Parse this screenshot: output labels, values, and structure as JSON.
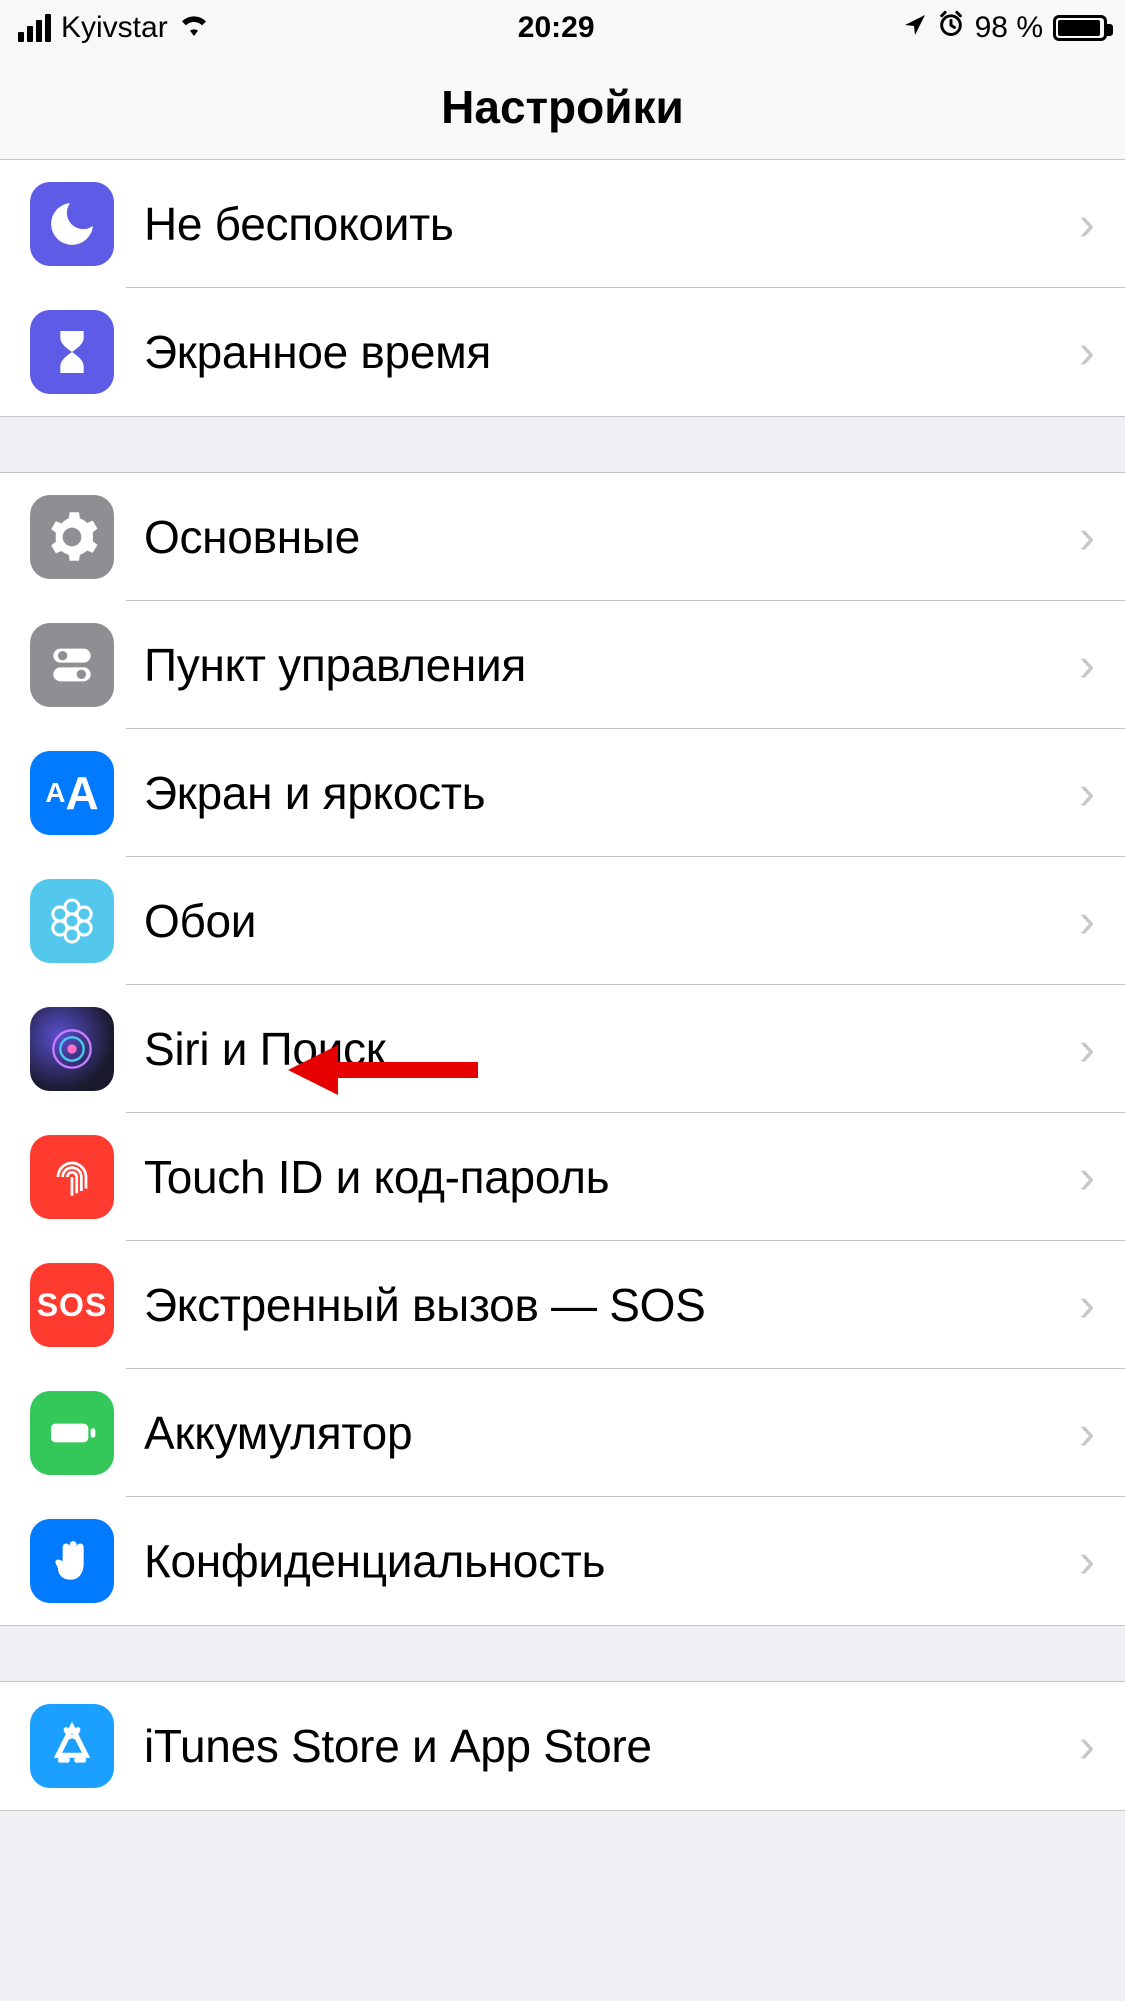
{
  "status_bar": {
    "carrier": "Kyivstar",
    "time": "20:29",
    "battery_pct": "98 %"
  },
  "header": {
    "title": "Настройки"
  },
  "sections": [
    {
      "rows": [
        {
          "id": "dnd",
          "label": "Не беспокоить"
        },
        {
          "id": "screentime",
          "label": "Экранное время"
        }
      ]
    },
    {
      "rows": [
        {
          "id": "general",
          "label": "Основные"
        },
        {
          "id": "control",
          "label": "Пункт управления"
        },
        {
          "id": "display",
          "label": "Экран и яркость"
        },
        {
          "id": "wallpaper",
          "label": "Обои"
        },
        {
          "id": "siri",
          "label": "Siri и Поиск"
        },
        {
          "id": "touchid",
          "label": "Touch ID и код-пароль"
        },
        {
          "id": "sos",
          "label": "Экстренный вызов — SOS"
        },
        {
          "id": "battery",
          "label": "Аккумулятор"
        },
        {
          "id": "privacy",
          "label": "Конфиденциальность"
        }
      ]
    },
    {
      "rows": [
        {
          "id": "itunes",
          "label": "iTunes Store и App Store"
        }
      ]
    }
  ],
  "icons": {
    "display_label": "AA",
    "sos_label": "SOS"
  },
  "annotation": {
    "target_row": "wallpaper"
  }
}
